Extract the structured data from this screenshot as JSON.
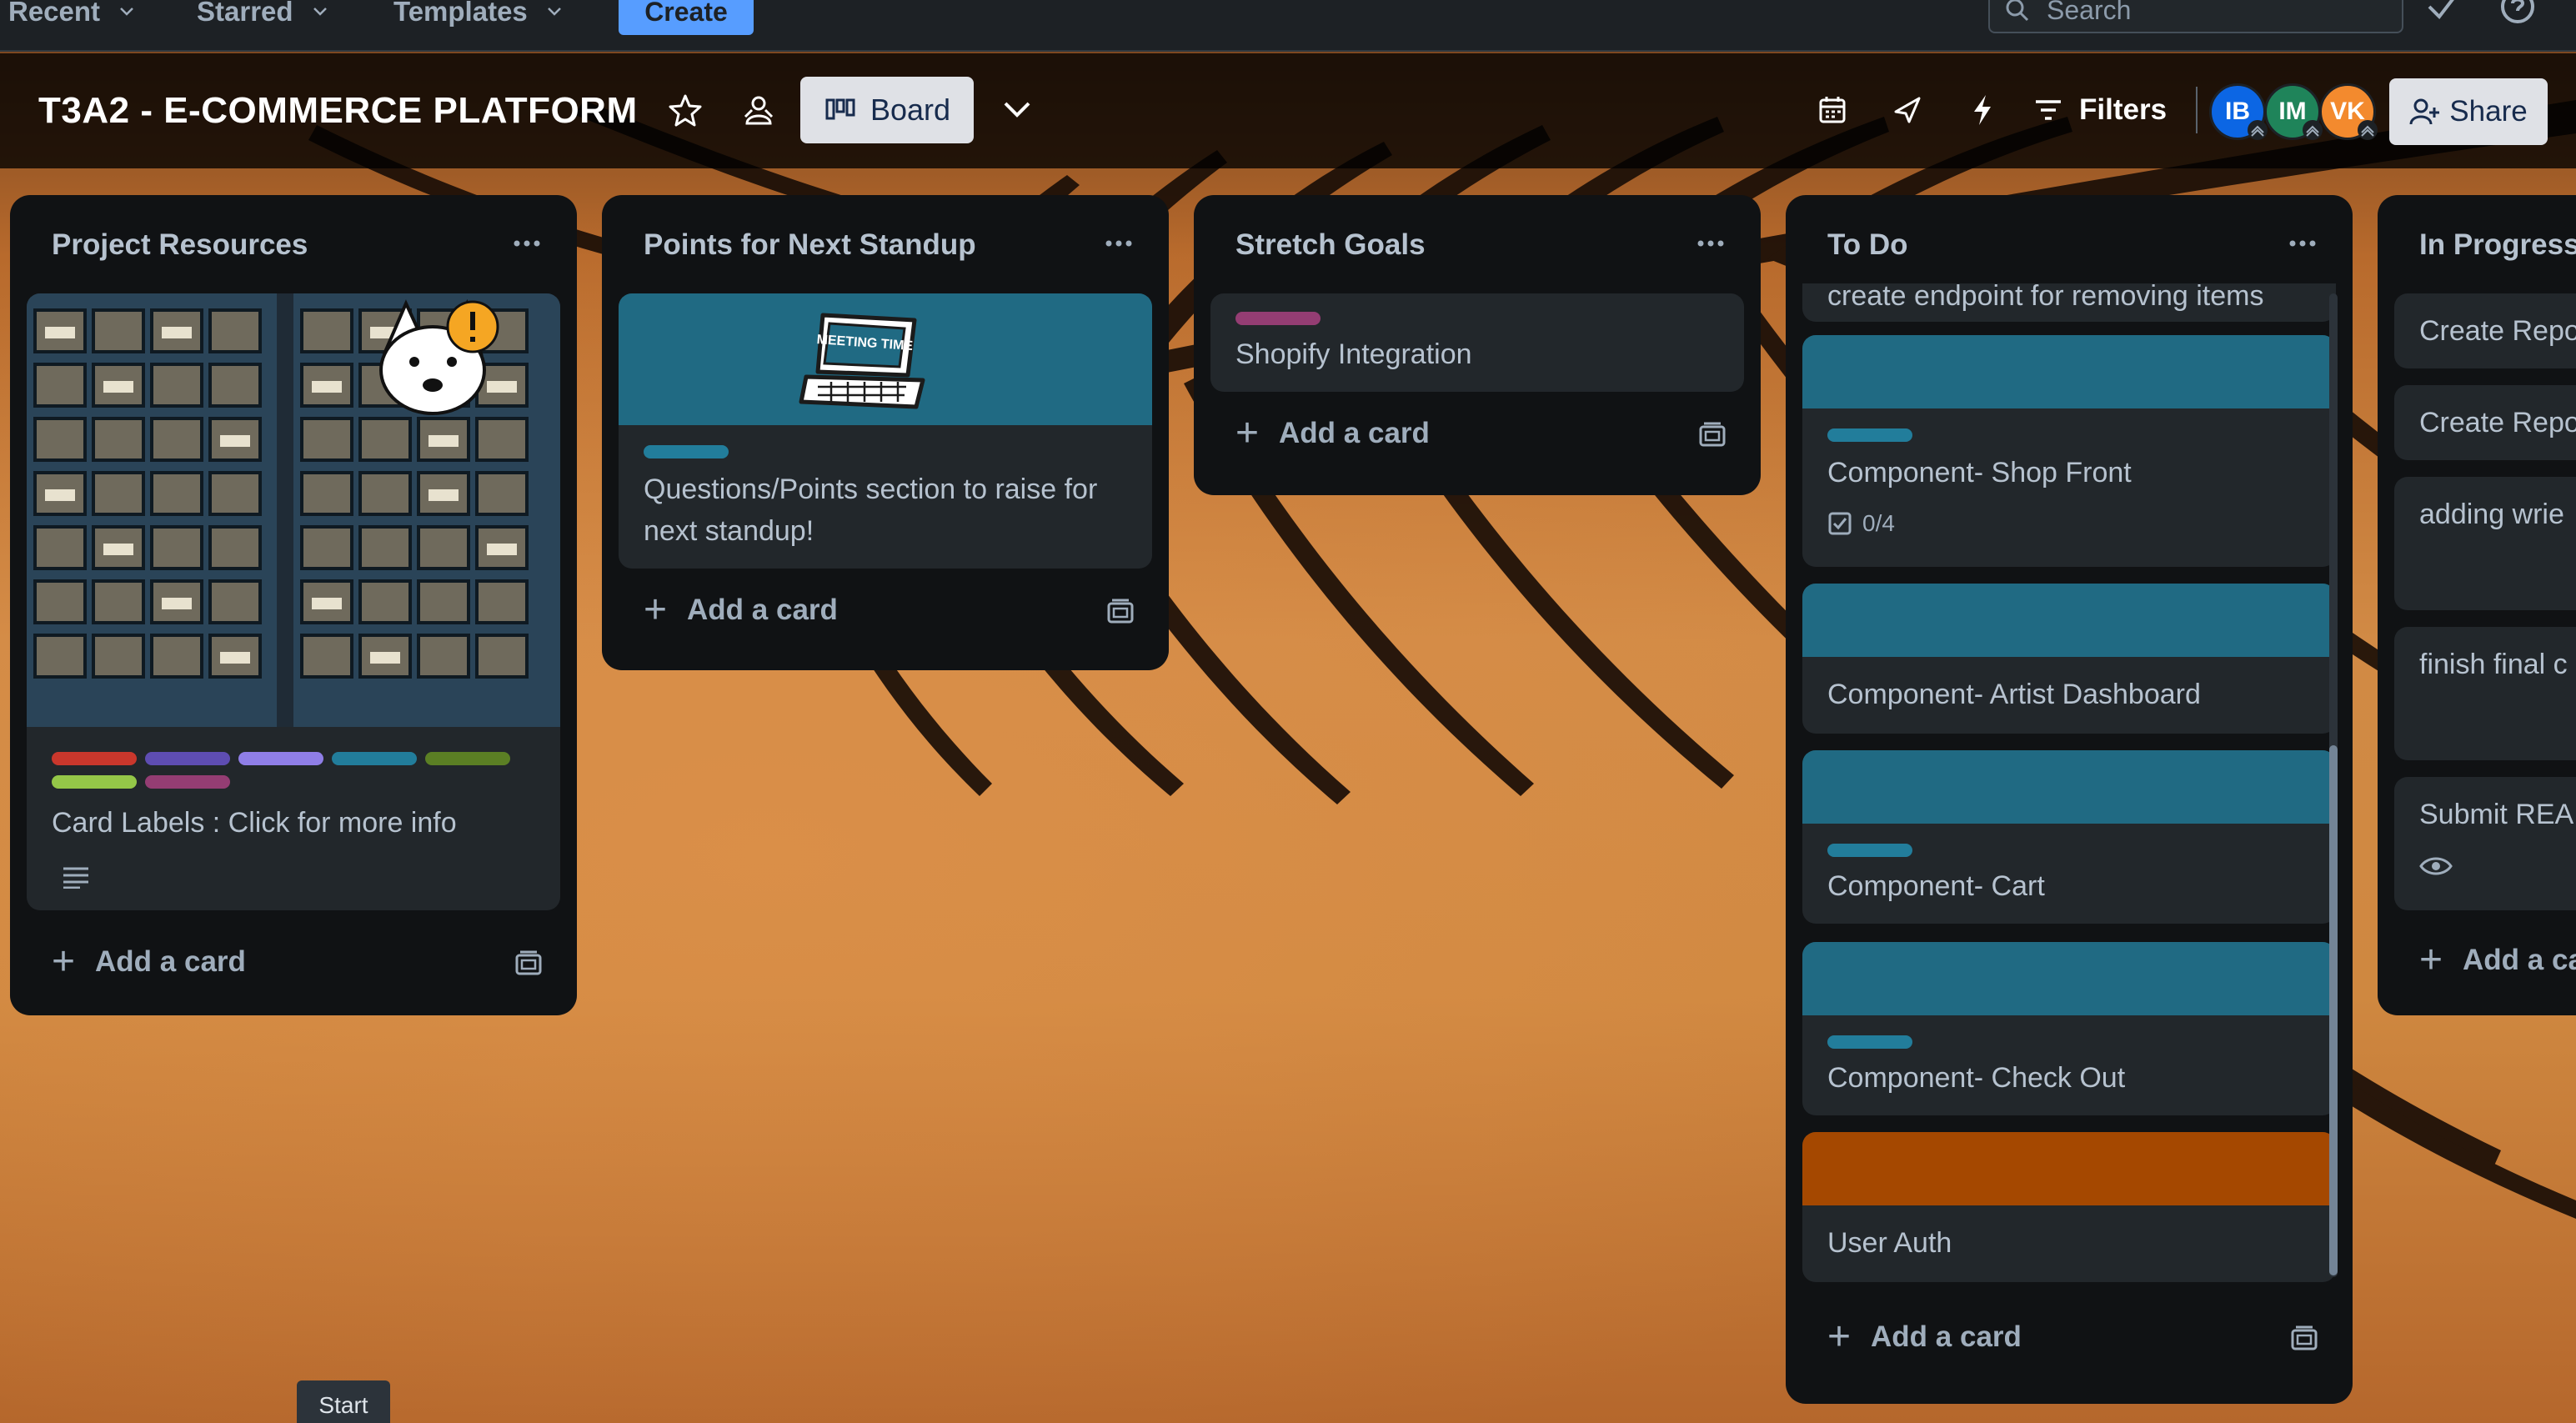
{
  "nav": {
    "recent": "Recent",
    "starred": "Starred",
    "templates": "Templates",
    "create": "Create",
    "search_placeholder": "Search"
  },
  "board": {
    "title": "T3A2 - E-COMMERCE PLATFORM",
    "view_label": "Board",
    "filters_label": "Filters",
    "share_label": "Share",
    "members": [
      {
        "initials": "IB",
        "color": "#0c66e4"
      },
      {
        "initials": "IM",
        "color": "#1f845a"
      },
      {
        "initials": "VK",
        "color": "#f38a2e"
      }
    ]
  },
  "lists": [
    {
      "title": "Project Resources",
      "add_card": "Add a card",
      "cards": [
        {
          "text": "Card Labels : Click for more info",
          "labels": [
            "#c9372c",
            "#5e4db2",
            "#8f7ee7",
            "#227d9b",
            "#5b7f24",
            "#94c748",
            "#943d73"
          ]
        }
      ]
    },
    {
      "title": "Points for Next Standup",
      "add_card": "Add a card",
      "cards": [
        {
          "text": "Questions/Points section to raise for next standup!",
          "cover": "#206a83",
          "sticker_text": "MEETING TIME"
        }
      ]
    },
    {
      "title": "Stretch Goals",
      "add_card": "Add a card",
      "cards": [
        {
          "text": "Shopify Integration",
          "label": "#943d73"
        }
      ]
    },
    {
      "title": "To Do",
      "add_card": "Add a card",
      "cards": [
        {
          "text": "create endpoint for removing items"
        },
        {
          "text": "Component- Shop Front",
          "cover": "#206a83",
          "checklist": "0/4"
        },
        {
          "text": "Component- Artist Dashboard",
          "cover": "#206a83"
        },
        {
          "text": "Component- Cart",
          "cover": "#206a83"
        },
        {
          "text": "Component- Check Out",
          "cover": "#206a83"
        },
        {
          "text": "User Auth",
          "cover": "#a54800"
        }
      ]
    },
    {
      "title": "In Progress",
      "add_card": "Add a ca",
      "cards": [
        {
          "text": "Create Repo"
        },
        {
          "text": "Create Repo"
        },
        {
          "text": "adding wrie"
        },
        {
          "text": "finish final c"
        },
        {
          "text": "Submit REAI"
        }
      ]
    }
  ],
  "tooltip": "Start"
}
